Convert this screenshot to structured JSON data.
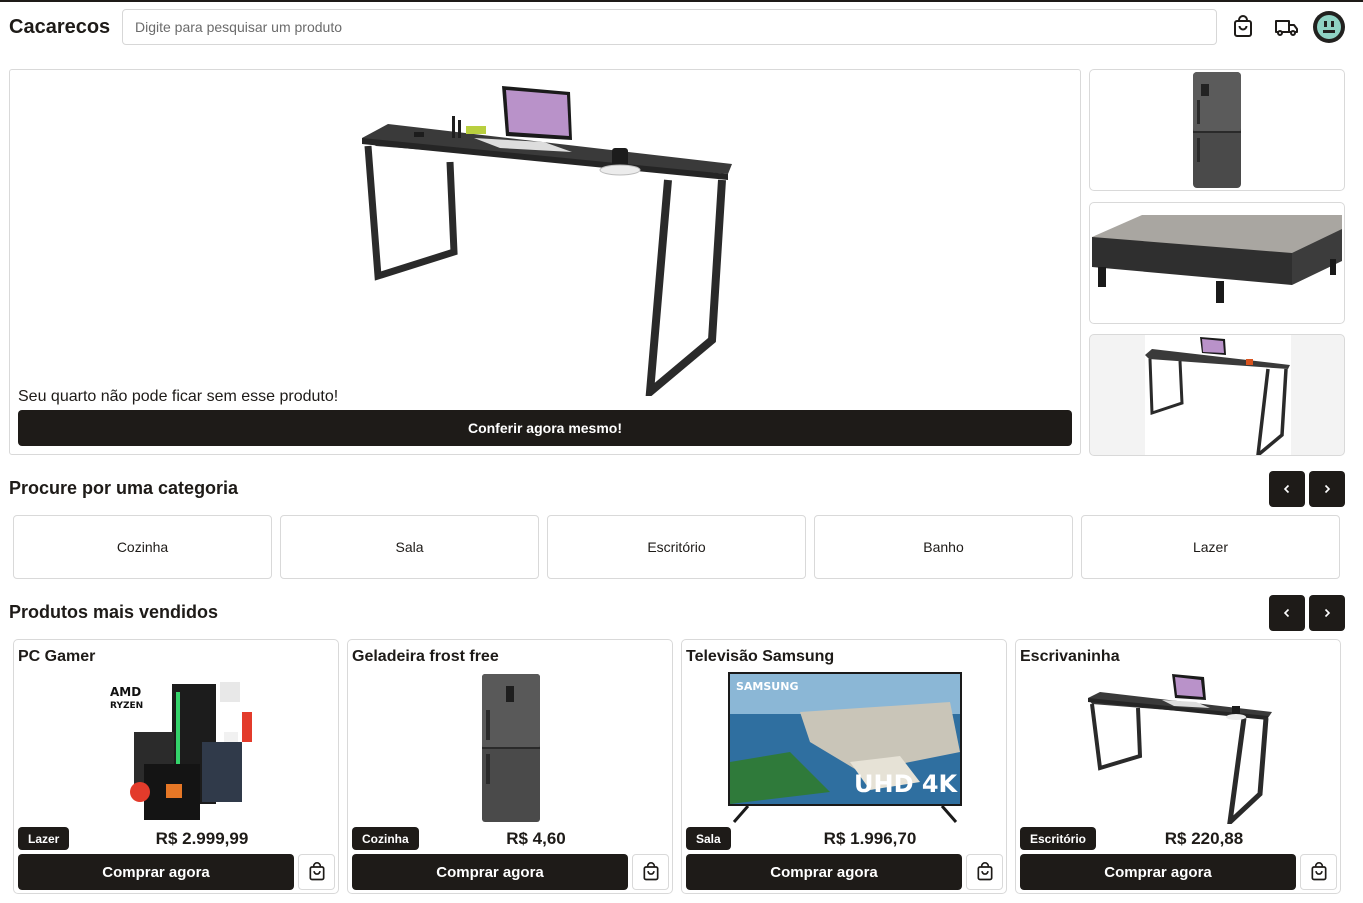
{
  "header": {
    "logo": "Cacarecos",
    "search_placeholder": "Digite para pesquisar um produto",
    "icons": [
      "shopping-bag-icon",
      "truck-icon",
      "avatar-icon"
    ]
  },
  "hero": {
    "image": "desk-icon",
    "caption": "Seu quarto não pode ficar sem esse produto!",
    "cta_label": "Conferir agora mesmo!",
    "thumbnails": [
      "refrigerator-icon",
      "bed-icon",
      "desk-icon"
    ]
  },
  "categories": {
    "title": "Procure por uma categoria",
    "items": [
      "Cozinha",
      "Sala",
      "Escritório",
      "Banho",
      "Lazer"
    ]
  },
  "bestsellers": {
    "title": "Produtos mais vendidos",
    "buy_label": "Comprar agora",
    "products": [
      {
        "name": "PC Gamer",
        "category": "Lazer",
        "price": "R$ 2.999,99",
        "image": "pc-gamer-icon"
      },
      {
        "name": "Geladeira frost free",
        "category": "Cozinha",
        "price": "R$ 4,60",
        "image": "refrigerator-icon"
      },
      {
        "name": "Televisão Samsung",
        "category": "Sala",
        "price": "R$ 1.996,70",
        "image": "television-icon",
        "image_text": [
          "SAMSUNG",
          "UHD 4K"
        ]
      },
      {
        "name": "Escrivaninha",
        "category": "Escritório",
        "price": "R$ 220,88",
        "image": "desk-icon"
      }
    ]
  },
  "colors": {
    "primary": "#1e1b18",
    "border": "#d9d9d9",
    "background": "#ffffff"
  }
}
